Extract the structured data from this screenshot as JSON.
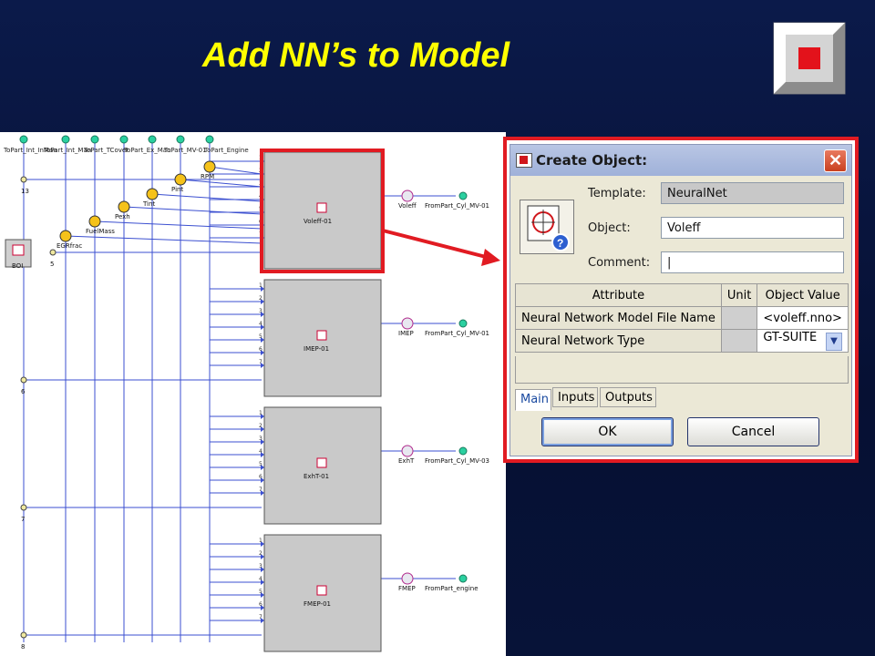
{
  "slide": {
    "title": "Add NN’s to Model",
    "colors": {
      "title": "#ffff00",
      "background": "#061033",
      "highlight": "#e11b22"
    }
  },
  "diagram": {
    "top_labels": [
      "ToPart_Int_InMan",
      "ToPart_Int_Man",
      "ToPart_TCover",
      "ToPart_Ex_Man",
      "ToPart_MV-01",
      "ToPart_Engine"
    ],
    "sensors": [
      "RPM",
      "Pint",
      "Tint",
      "Pexh",
      "FuelMass",
      "EGRfrac"
    ],
    "boi_label": "BOI",
    "junction_labels": [
      "13",
      "5",
      "6",
      "7",
      "8"
    ],
    "blocks": [
      {
        "name": "Voleff-01",
        "output": "Voleff",
        "target": "FromPart_Cyl_MV-01"
      },
      {
        "name": "IMEP-01",
        "output": "IMEP",
        "target": "FromPart_Cyl_MV-01"
      },
      {
        "name": "ExhT-01",
        "output": "ExhT",
        "target": "FromPart_Cyl_MV-03"
      },
      {
        "name": "FMEP-01",
        "output": "FMEP",
        "target": "FromPart_engine"
      }
    ],
    "port_numbers": [
      "1",
      "2",
      "3",
      "4",
      "5",
      "6",
      "7"
    ]
  },
  "dialog": {
    "title": "Create Object:",
    "template_label": "Template:",
    "template_value": "NeuralNet",
    "object_label": "Object:",
    "object_value": "Voleff",
    "comment_label": "Comment:",
    "comment_value": "|",
    "table": {
      "headers": [
        "Attribute",
        "Unit",
        "Object Value"
      ],
      "rows": [
        {
          "attribute": "Neural Network Model File Name",
          "unit": "",
          "value": "<voleff.nno>"
        },
        {
          "attribute": "Neural Network Type",
          "unit": "",
          "value": "GT-SUITE"
        }
      ]
    },
    "tabs": [
      "Main",
      "Inputs",
      "Outputs"
    ],
    "ok_label": "OK",
    "cancel_label": "Cancel",
    "close_symbol": "✕"
  }
}
